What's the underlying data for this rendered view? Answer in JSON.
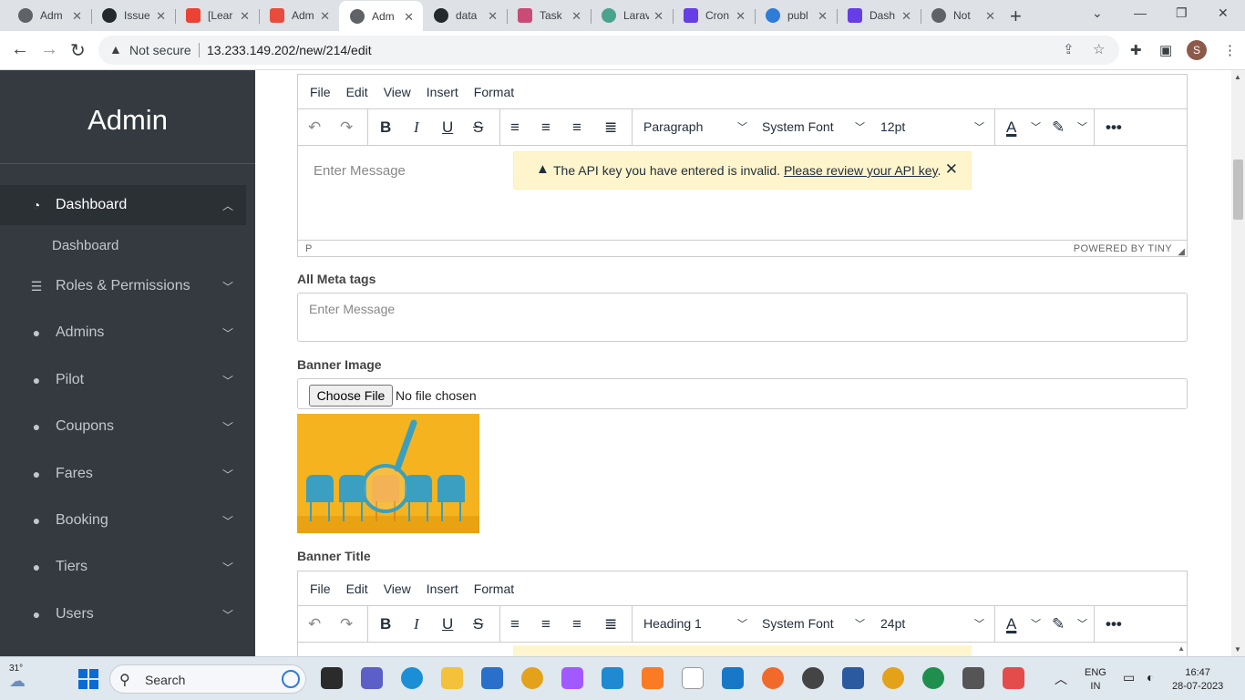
{
  "browser": {
    "tabs": [
      {
        "label": "Adm",
        "icon": "globe-icon",
        "color": "#5f6368"
      },
      {
        "label": "Issue",
        "icon": "github-icon",
        "color": "#24292e"
      },
      {
        "label": "[Lear",
        "icon": "gmail-icon",
        "color": "#ea4335"
      },
      {
        "label": "Adm",
        "icon": "app-icon",
        "color": "#e94c3d"
      },
      {
        "label": "Adm",
        "icon": "globe-icon",
        "color": "#5f6368"
      },
      {
        "label": "data",
        "icon": "github-icon",
        "color": "#24292e"
      },
      {
        "label": "Task",
        "icon": "laravel-icon",
        "color": "#c94b76"
      },
      {
        "label": "Larav",
        "icon": "chatgpt-icon",
        "color": "#4aa38c"
      },
      {
        "label": "Cron",
        "icon": "hostinger-icon",
        "color": "#673de6"
      },
      {
        "label": "publ",
        "icon": "globe-blue-icon",
        "color": "#2f7bd8"
      },
      {
        "label": "Dash",
        "icon": "hostinger-icon",
        "color": "#673de6"
      },
      {
        "label": "Not",
        "icon": "globe-icon",
        "color": "#5f6368"
      }
    ],
    "active_tab_index": 4,
    "security_label": "Not secure",
    "url": "13.233.149.202/new/214/edit",
    "profile_initial": "S"
  },
  "sidebar": {
    "brand": "Admin",
    "items": [
      {
        "label": "Dashboard",
        "icon": "dashboard-gauge-icon",
        "active": true,
        "expanded": true
      },
      {
        "label": "Roles & Permissions",
        "icon": "list-check-icon"
      },
      {
        "label": "Admins",
        "icon": "user-icon"
      },
      {
        "label": "Pilot",
        "icon": "user-icon"
      },
      {
        "label": "Coupons",
        "icon": "user-icon"
      },
      {
        "label": "Fares",
        "icon": "user-icon"
      },
      {
        "label": "Booking",
        "icon": "user-icon"
      },
      {
        "label": "Tiers",
        "icon": "user-icon"
      },
      {
        "label": "Users",
        "icon": "user-icon"
      }
    ],
    "sub_items": [
      {
        "label": "Dashboard"
      }
    ]
  },
  "editor1": {
    "menu": [
      "File",
      "Edit",
      "View",
      "Insert",
      "Format"
    ],
    "block_format": "Paragraph",
    "font_family": "System Font",
    "font_size": "12pt",
    "placeholder": "Enter Message",
    "status_path": "P",
    "powered_by": "POWERED BY TINY",
    "notice": {
      "text": "The API key you have entered is invalid.",
      "link": "Please review your API key",
      "suffix": "."
    }
  },
  "meta_tags": {
    "label": "All Meta tags",
    "placeholder": "Enter Message"
  },
  "banner_image": {
    "label": "Banner Image",
    "button": "Choose File",
    "status": "No file chosen"
  },
  "banner_title": {
    "label": "Banner Title"
  },
  "editor2": {
    "menu": [
      "File",
      "Edit",
      "View",
      "Insert",
      "Format"
    ],
    "block_format": "Heading 1",
    "font_family": "System Font",
    "font_size": "24pt"
  },
  "taskbar": {
    "weather": "31°",
    "search_label": "Search",
    "lang_line1": "ENG",
    "lang_line2": "IN",
    "time": "16:47",
    "date": "28-07-2023"
  },
  "colors": {
    "sidebar_bg": "#343a40",
    "notice_bg": "#fff5cc",
    "banner_yellow": "#f4b31f",
    "chair_blue": "#3a9fc0"
  }
}
